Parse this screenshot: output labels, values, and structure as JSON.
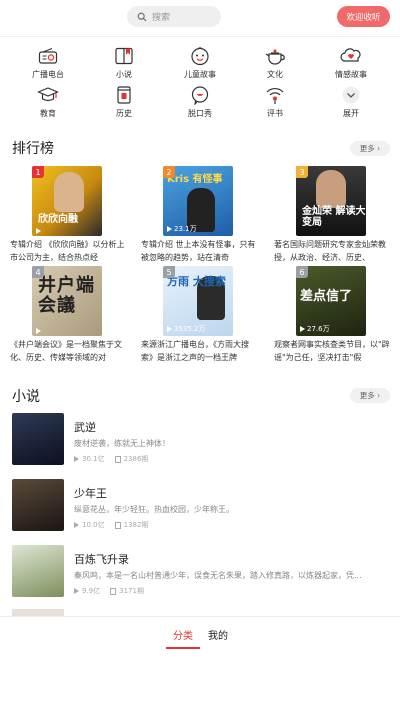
{
  "search": {
    "placeholder": "搜索"
  },
  "login_label": "欢迎收听",
  "categories": [
    {
      "label": "广播电台",
      "icon": "radio-icon"
    },
    {
      "label": "小说",
      "icon": "book-icon"
    },
    {
      "label": "儿童故事",
      "icon": "kid-face-icon"
    },
    {
      "label": "文化",
      "icon": "teapot-icon"
    },
    {
      "label": "情感故事",
      "icon": "heart-cloud-icon"
    },
    {
      "label": "教育",
      "icon": "graduation-cap-icon"
    },
    {
      "label": "历史",
      "icon": "scroll-icon"
    },
    {
      "label": "脱口秀",
      "icon": "chat-bubble-icon"
    },
    {
      "label": "评书",
      "icon": "broadcast-wave-icon"
    },
    {
      "label": "展开",
      "icon": "chevron-down-icon"
    }
  ],
  "ranking": {
    "title": "排行榜",
    "more_label": "更多",
    "items": [
      {
        "rank": "1",
        "desc": "专辑介绍 《欣欣向融》以分析上市公司为主，结合热点经",
        "cover_text": "欣欣向融",
        "badge_color": "#e63232"
      },
      {
        "rank": "2",
        "plays": "23.1万",
        "desc": "专辑介绍 世上本没有怪事，只有被忽略的趋势，站在清奇",
        "cover_text": "Kris 有怪事",
        "badge_color": "#f08a2c"
      },
      {
        "rank": "3",
        "desc": "著名国际问题研究专家金灿荣教授，从政治、经济、历史、",
        "cover_text": "金灿荣 解读大变局",
        "badge_color": "#f2b134"
      },
      {
        "rank": "4",
        "desc": "《井户端会议》是一档聚焦于文化、历史、传媒等领域的对",
        "cover_text": "井户端 会議",
        "badge_color": "#9aa0a6"
      },
      {
        "rank": "5",
        "plays": "3535.2万",
        "desc": "来源浙江广播电台，《方雨大搜索》是浙江之声的一档王牌",
        "cover_text": "方雨 大搜索",
        "badge_color": "#9aa0a6"
      },
      {
        "rank": "6",
        "plays": "27.6万",
        "desc": "观察者网事实核查类节目，以\"辟谣\"为己任，坚决打击\"假",
        "cover_text": "差点信了",
        "badge_color": "#9aa0a6"
      }
    ]
  },
  "novels": {
    "title": "小说",
    "more_label": "更多",
    "items": [
      {
        "name": "武逆",
        "desc": "废材逆袭，练就无上神体！",
        "plays": "30.1亿",
        "episodes": "2386期"
      },
      {
        "name": "少年王",
        "desc": "纵意花丛，年少轻狂。热血校园，少年称王。",
        "plays": "10.0亿",
        "episodes": "1382期"
      },
      {
        "name": "百炼飞升录",
        "desc": "秦风鸣，本是一名山村普通少年，误食无名朱果，踏入修真路，以炼器起家，凭...",
        "plays": "9.9亿",
        "episodes": "3171期"
      }
    ]
  },
  "tabbar": {
    "tabs": [
      "分类",
      "我的"
    ],
    "active": 0,
    "accent": "#e63232"
  }
}
